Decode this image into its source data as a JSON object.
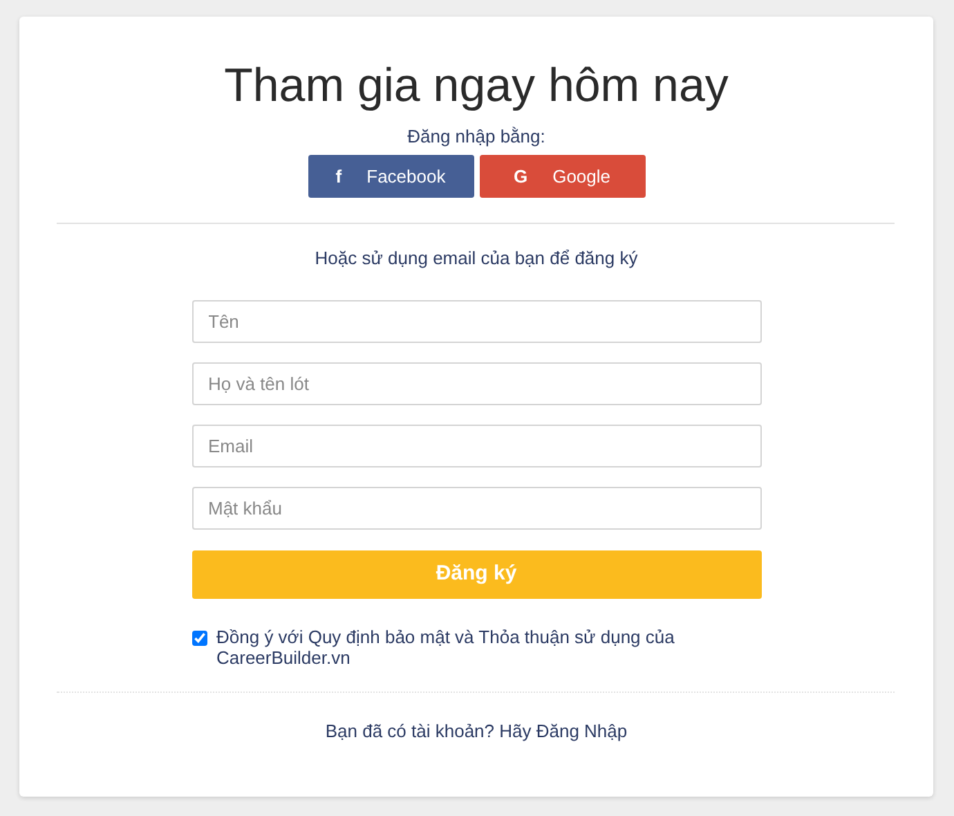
{
  "title": "Tham gia ngay hôm nay",
  "social_prompt": "Đăng nhập bằng:",
  "social_buttons": [
    {
      "kind": "facebook",
      "label": "Facebook",
      "icon": "f"
    },
    {
      "kind": "google",
      "label": "Google",
      "icon": "G"
    }
  ],
  "email_prompt": "Hoặc sử dụng email của bạn để đăng ký",
  "fields": [
    {
      "placeholder": "Tên"
    },
    {
      "placeholder": "Họ và tên lót"
    },
    {
      "placeholder": "Email"
    },
    {
      "placeholder": "Mật khẩu"
    }
  ],
  "submit": "Đăng ký",
  "agreement": {
    "checked": true,
    "label": "Đồng ý với Quy định bảo mật và Thỏa thuận sử dụng của CareerBuilder.vn"
  },
  "login_prompt": "Bạn đã có tài khoản? Hãy Đăng Nhập"
}
